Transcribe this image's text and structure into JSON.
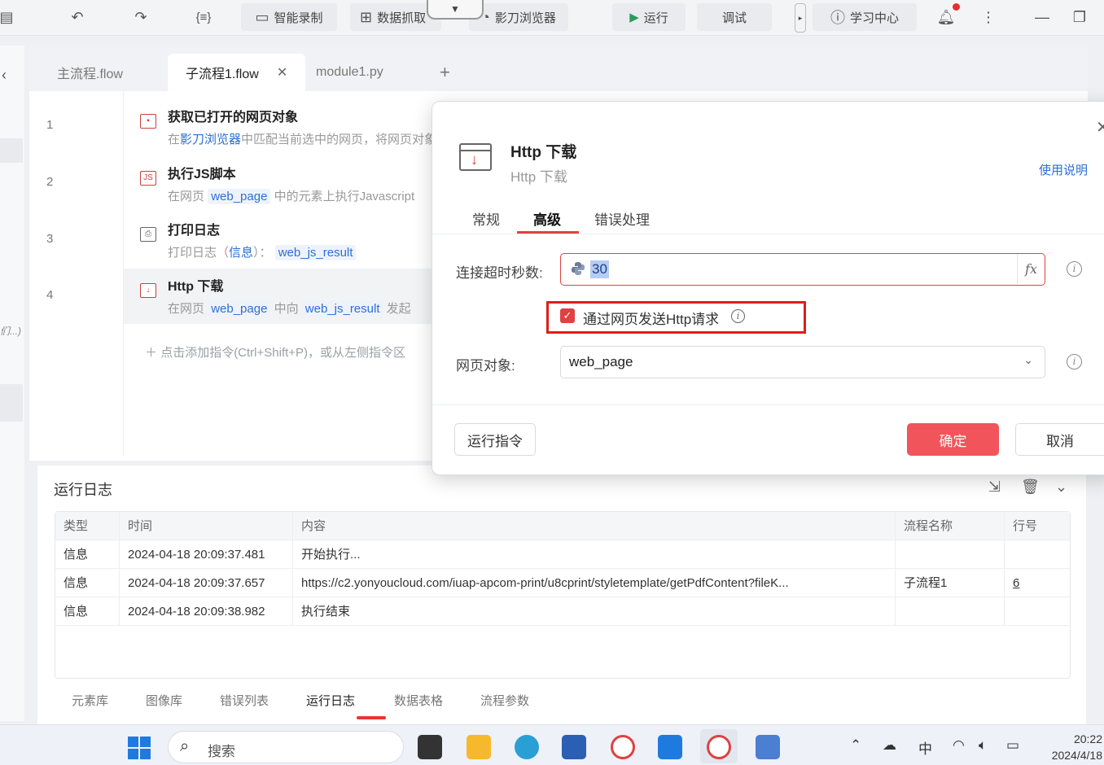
{
  "toolbar": {
    "record_label": "智能录制",
    "scrape_label": "数据抓取",
    "browser_label": "影刀浏览器",
    "run_label": "运行",
    "debug_label": "调试",
    "learn_label": "学习中心"
  },
  "tabs": [
    {
      "label": "主流程.flow"
    },
    {
      "label": "子流程1.flow"
    },
    {
      "label": "module1.py"
    }
  ],
  "steps": [
    {
      "line": "1",
      "title": "获取已打开的网页对象",
      "desc_pre": "在",
      "desc_link": "影刀浏览器",
      "desc_post": "中匹配当前选中的网页，将网页对象"
    },
    {
      "line": "2",
      "title": "执行JS脚本",
      "desc_pre": "在网页",
      "desc_var": "web_page",
      "desc_post": "中的元素上执行Javascript"
    },
    {
      "line": "3",
      "title": "打印日志",
      "desc_pre": "打印日志（",
      "desc_link": "信息",
      "desc_mid": "）：",
      "desc_var": "web_js_result"
    },
    {
      "line": "4",
      "title": "Http 下载",
      "desc_pre": "在网页",
      "desc_var": "web_page",
      "desc_mid": "中向",
      "desc_var2": "web_js_result",
      "desc_post": "发起"
    }
  ],
  "add_hint": "点击添加指令(Ctrl+Shift+P)，或从左侧指令区",
  "left_fragment": "们...)",
  "dialog": {
    "title": "Http 下载",
    "subtitle": "Http 下载",
    "help_link": "使用说明",
    "tabs": [
      "常规",
      "高级",
      "错误处理"
    ],
    "active_tab": "高级",
    "timeout_label": "连接超时秒数:",
    "timeout_value": "30",
    "fx_label": "fx",
    "checkbox_label": "通过网页发送Http请求",
    "checkbox_checked": true,
    "page_label": "网页对象:",
    "page_value": "web_page",
    "run_button": "运行指令",
    "ok_button": "确定",
    "cancel_button": "取消"
  },
  "log": {
    "title": "运行日志",
    "headers": [
      "类型",
      "时间",
      "内容",
      "流程名称",
      "行号"
    ],
    "rows": [
      {
        "type": "信息",
        "time": "2024-04-18 20:09:37.481",
        "content": "开始执行...",
        "flow": "",
        "line": ""
      },
      {
        "type": "信息",
        "time": "2024-04-18 20:09:37.657",
        "content": "https://c2.yonyoucloud.com/iuap-apcom-print/u8cprint/styletemplate/getPdfContent?fileK...",
        "flow": "子流程1",
        "line": "6"
      },
      {
        "type": "信息",
        "time": "2024-04-18 20:09:38.982",
        "content": "执行结束",
        "flow": "",
        "line": ""
      }
    ]
  },
  "bottom_tabs": [
    "元素库",
    "图像库",
    "错误列表",
    "运行日志",
    "数据表格",
    "流程参数"
  ],
  "bottom_active": "运行日志",
  "taskbar": {
    "search_text": "搜索",
    "ime": "中",
    "time": "20:22",
    "date": "2024/4/18"
  },
  "colors": {
    "accent": "#e04141",
    "primary_button": "#f2545b",
    "link": "#2b6fd6"
  }
}
